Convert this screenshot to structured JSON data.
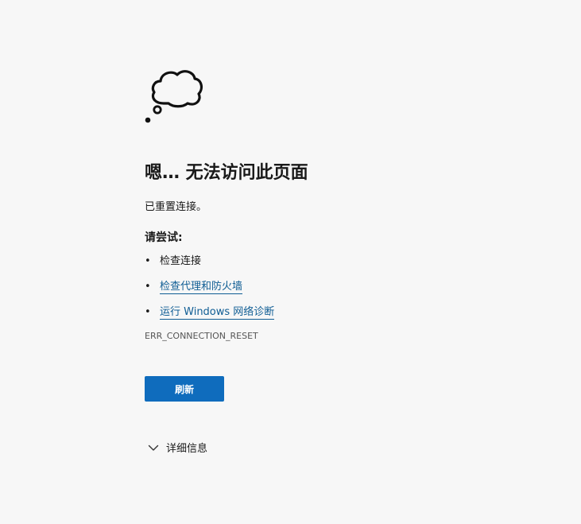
{
  "error": {
    "icon": "thought-cloud-icon",
    "title": "嗯… 无法访问此页面",
    "message": "已重置连接。",
    "try_heading": "请尝试:",
    "suggestions": [
      {
        "label": "检查连接",
        "is_link": false
      },
      {
        "label": "检查代理和防火墙",
        "is_link": true
      },
      {
        "label": "运行 Windows 网络诊断",
        "is_link": true
      }
    ],
    "bullet": "•",
    "error_code": "ERR_CONNECTION_RESET",
    "refresh_label": "刷新",
    "details_label": "详细信息",
    "details_icon": "chevron-down-icon"
  },
  "colors": {
    "background": "#f7f7f7",
    "link": "#0f5d94",
    "button": "#0f6cbd"
  }
}
